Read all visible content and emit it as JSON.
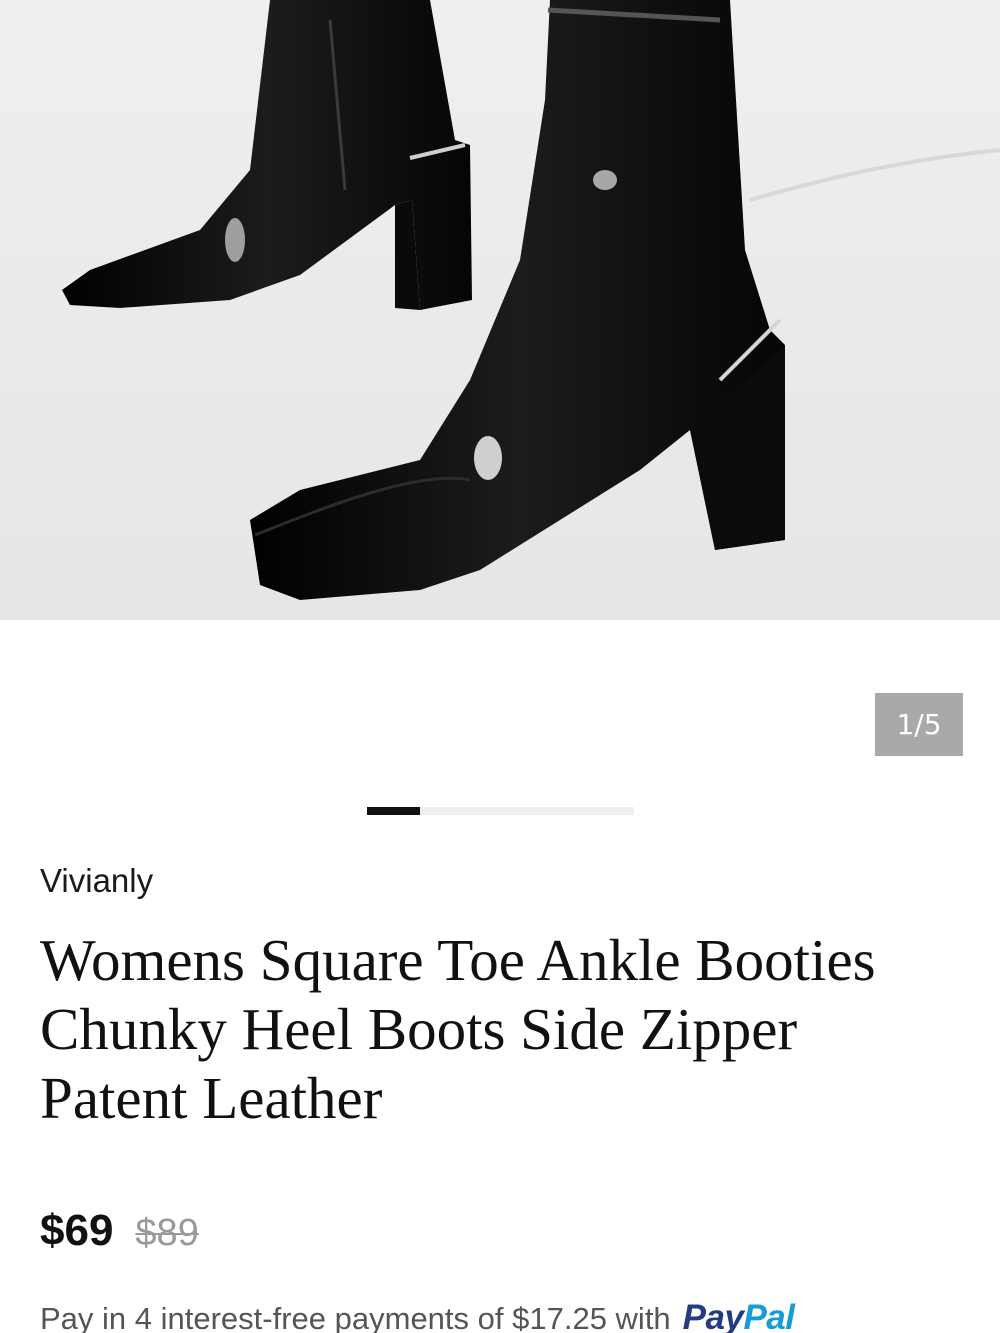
{
  "gallery": {
    "image_alt": "Black patent leather square toe ankle boots with chunky heels",
    "counter": "1/5",
    "progress": {
      "current": 1,
      "total": 5
    }
  },
  "product": {
    "brand": "Vivianly",
    "title": "Womens Square Toe Ankle Booties Chunky Heel Boots Side Zipper Patent Leather",
    "price": "$69",
    "original_price": "$89"
  },
  "payment": {
    "installment_text": "Pay in 4 interest-free payments of $17.25 with",
    "paypal_part1": "Pay",
    "paypal_part2": "Pal"
  },
  "colors": {
    "counter_bg": "#a9a9a9",
    "progress_fill": "#111111",
    "paypal_dark": "#253b80",
    "paypal_light": "#179bd7"
  }
}
